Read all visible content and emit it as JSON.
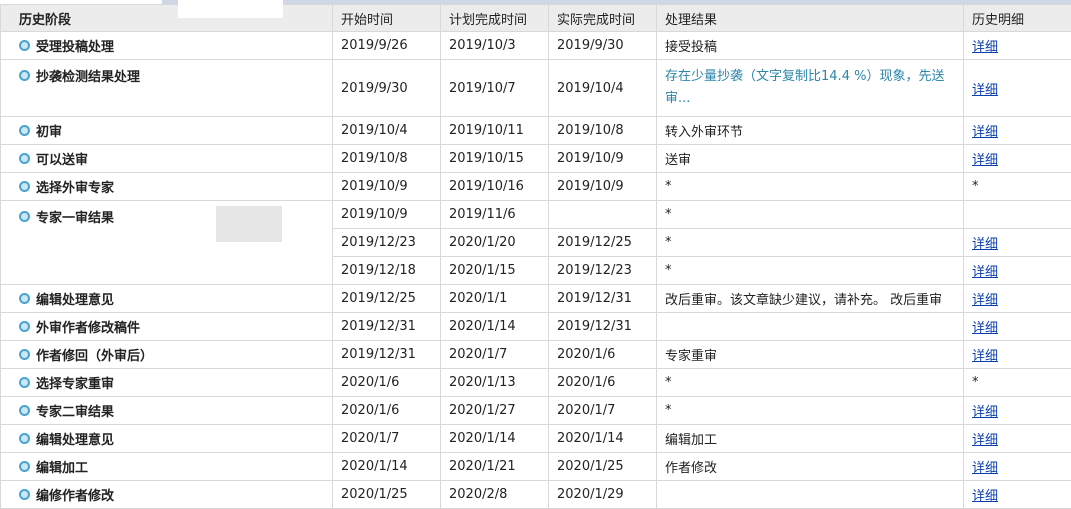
{
  "header": {
    "stage": "历史阶段",
    "start": "开始时间",
    "planned": "计划完成时间",
    "actual": "实际完成时间",
    "result": "处理结果",
    "detail": "历史明细"
  },
  "rows": [
    {
      "stage": "受理投稿处理",
      "start": "2019/9/26",
      "planned": "2019/10/3",
      "actual": "2019/9/30",
      "result": "接受投稿",
      "detail": "详细"
    },
    {
      "stage": "抄袭检测结果处理",
      "start": "2019/9/30",
      "planned": "2019/10/7",
      "actual": "2019/10/4",
      "result": "存在少量抄袭（文字复制比14.4 %）现象，先送审...",
      "detail": "详细"
    },
    {
      "stage": "初审",
      "start": "2019/10/4",
      "planned": "2019/10/11",
      "actual": "2019/10/8",
      "result": "转入外审环节",
      "detail": "详细"
    },
    {
      "stage": "可以送审",
      "start": "2019/10/8",
      "planned": "2019/10/15",
      "actual": "2019/10/9",
      "result": "送审",
      "detail": "详细"
    },
    {
      "stage": "选择外审专家",
      "start": "2019/10/9",
      "planned": "2019/10/16",
      "actual": "2019/10/9",
      "result": "*",
      "detail": "*"
    },
    {
      "stage": "专家一审结果",
      "start": "2019/10/9",
      "planned": "2019/11/6",
      "actual": "",
      "result": "*",
      "detail": ""
    },
    {
      "stage": "",
      "start": "2019/12/23",
      "planned": "2020/1/20",
      "actual": "2019/12/25",
      "result": "*",
      "detail": "详细"
    },
    {
      "stage": "",
      "start": "2019/12/18",
      "planned": "2020/1/15",
      "actual": "2019/12/23",
      "result": "*",
      "detail": "详细"
    },
    {
      "stage": "编辑处理意见",
      "start": "2019/12/25",
      "planned": "2020/1/1",
      "actual": "2019/12/31",
      "result": "改后重审。该文章缺少建议，请补充。 改后重审",
      "detail": "详细"
    },
    {
      "stage": "外审作者修改稿件",
      "start": "2019/12/31",
      "planned": "2020/1/14",
      "actual": "2019/12/31",
      "result": "",
      "detail": "详细"
    },
    {
      "stage": "作者修回（外审后）",
      "start": "2019/12/31",
      "planned": "2020/1/7",
      "actual": "2020/1/6",
      "result": "专家重审",
      "detail": "详细"
    },
    {
      "stage": "选择专家重审",
      "start": "2020/1/6",
      "planned": "2020/1/13",
      "actual": "2020/1/6",
      "result": "*",
      "detail": "*"
    },
    {
      "stage": "专家二审结果",
      "start": "2020/1/6",
      "planned": "2020/1/27",
      "actual": "2020/1/7",
      "result": "*",
      "detail": "详细"
    },
    {
      "stage": "编辑处理意见",
      "start": "2020/1/7",
      "planned": "2020/1/14",
      "actual": "2020/1/14",
      "result": "编辑加工",
      "detail": "详细"
    },
    {
      "stage": "编辑加工",
      "start": "2020/1/14",
      "planned": "2020/1/21",
      "actual": "2020/1/25",
      "result": "作者修改",
      "detail": "详细"
    },
    {
      "stage": "编修作者修改",
      "start": "2020/1/25",
      "planned": "2020/2/8",
      "actual": "2020/1/29",
      "result": "",
      "detail": "详细"
    }
  ]
}
